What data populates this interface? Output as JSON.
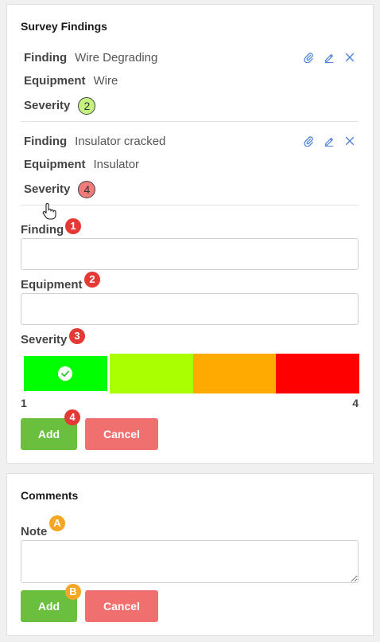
{
  "findings_section": {
    "title": "Survey Findings",
    "items": [
      {
        "finding_label": "Finding",
        "finding_value": "Wire Degrading",
        "equipment_label": "Equipment",
        "equipment_value": "Wire",
        "severity_label": "Severity",
        "severity_value": "2",
        "severity_color": "#c5f27e"
      },
      {
        "finding_label": "Finding",
        "finding_value": "Insulator cracked",
        "equipment_label": "Equipment",
        "equipment_value": "Insulator",
        "severity_label": "Severity",
        "severity_value": "4",
        "severity_color": "#ef7b7b"
      }
    ],
    "icons": [
      "paperclip-icon",
      "edit-icon",
      "close-icon"
    ],
    "form": {
      "finding_label": "Finding",
      "finding_badge": "1",
      "finding_value": "",
      "equipment_label": "Equipment",
      "equipment_badge": "2",
      "equipment_value": "",
      "severity_label": "Severity",
      "severity_badge": "3",
      "severity_scale": {
        "min_label": "1",
        "max_label": "4",
        "selected": 1,
        "colors": [
          "#00ff00",
          "#aaff00",
          "#ffaa00",
          "#ff0000"
        ]
      },
      "add_badge": "4",
      "add_label": "Add",
      "cancel_label": "Cancel"
    }
  },
  "comments_section": {
    "title": "Comments",
    "note_label": "Note",
    "note_badge": "A",
    "note_value": "",
    "add_badge": "B",
    "add_label": "Add",
    "cancel_label": "Cancel"
  },
  "colors": {
    "add_button": "#6abf3f",
    "cancel_button": "#f07070",
    "badge_red": "#e53935",
    "badge_amber": "#f5a623",
    "icon_blue": "#4a7fd8"
  }
}
